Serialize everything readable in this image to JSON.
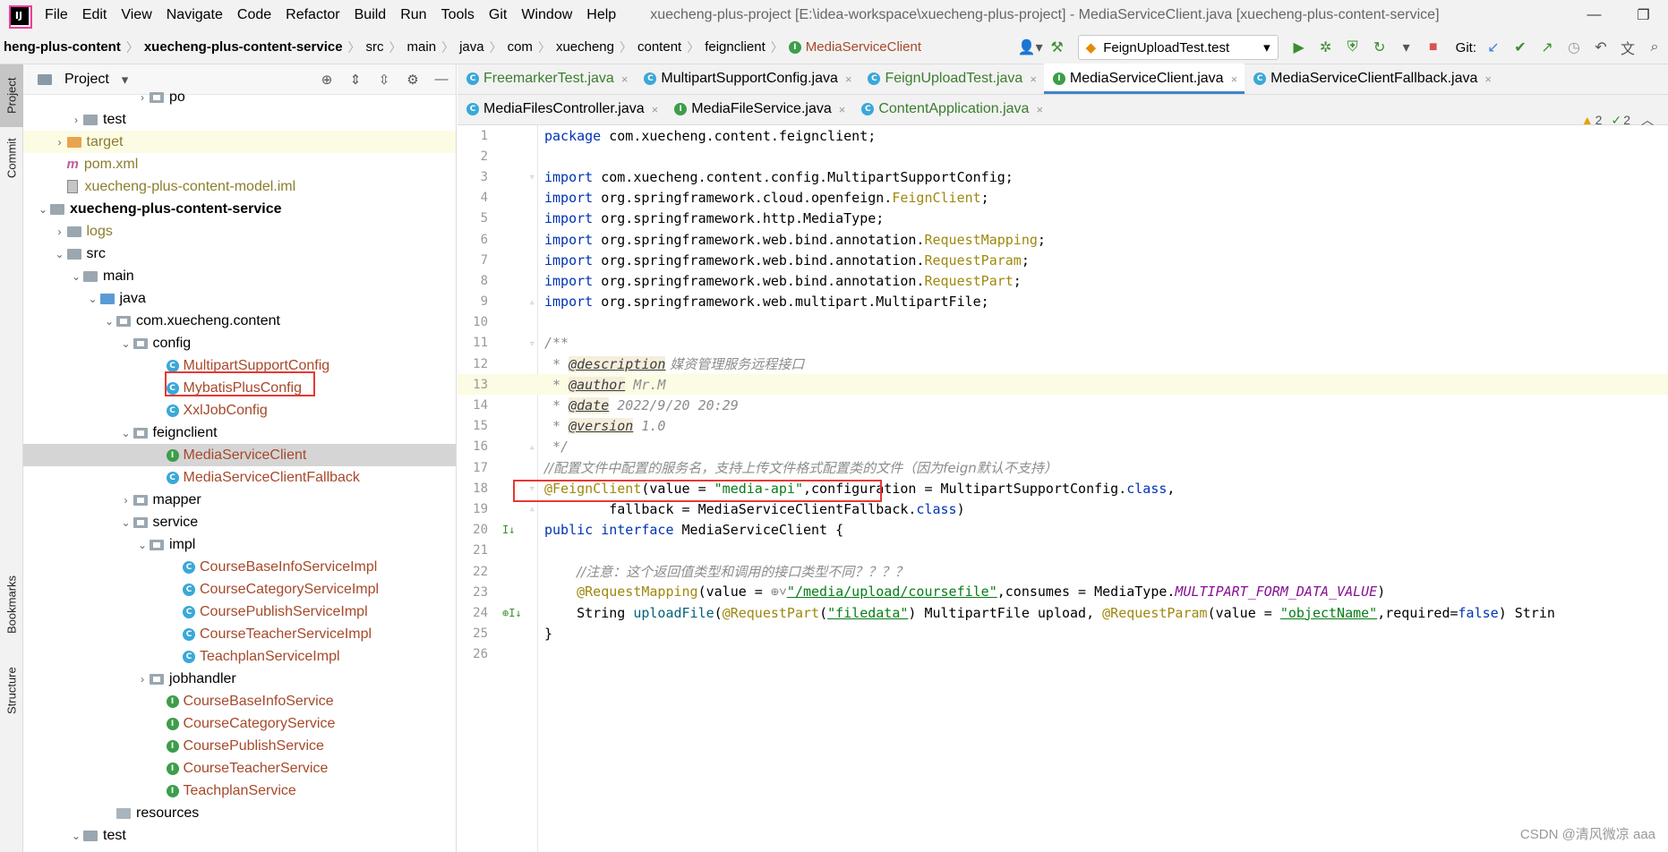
{
  "app": {
    "window_title": "xuecheng-plus-project [E:\\idea-workspace\\xuecheng-plus-project] - MediaServiceClient.java [xuecheng-plus-content-service]",
    "menu": [
      "File",
      "Edit",
      "View",
      "Navigate",
      "Code",
      "Refactor",
      "Build",
      "Run",
      "Tools",
      "Git",
      "Window",
      "Help"
    ]
  },
  "breadcrumb": [
    "heng-plus-content",
    "xuecheng-plus-content-service",
    "src",
    "main",
    "java",
    "com",
    "xuecheng",
    "content",
    "feignclient",
    "MediaServiceClient"
  ],
  "toolbar": {
    "run_config": "FeignUploadTest.test",
    "git_label": "Git:"
  },
  "left_strip": {
    "project": "Project",
    "commit": "Commit",
    "bookmarks": "Bookmarks",
    "structure": "Structure"
  },
  "project_panel": {
    "title": "Project",
    "tree": [
      {
        "label": "po",
        "kind": "pkg",
        "level": 8,
        "arrow": ">"
      },
      {
        "label": "test",
        "kind": "folder",
        "level": 4,
        "arrow": ">"
      },
      {
        "label": "target",
        "kind": "folder-orange",
        "level": 3,
        "arrow": ">",
        "color": "olive"
      },
      {
        "label": "pom.xml",
        "kind": "maven",
        "level": 3,
        "arrow": "",
        "color": "olive"
      },
      {
        "label": "xuecheng-plus-content-model.iml",
        "kind": "iml",
        "level": 3,
        "arrow": "",
        "color": "olive"
      },
      {
        "label": "xuecheng-plus-content-service",
        "kind": "module",
        "level": 2,
        "arrow": "v",
        "bold": true
      },
      {
        "label": "logs",
        "kind": "folder",
        "level": 3,
        "arrow": ">",
        "color": "olive"
      },
      {
        "label": "src",
        "kind": "folder",
        "level": 3,
        "arrow": "v"
      },
      {
        "label": "main",
        "kind": "folder",
        "level": 4,
        "arrow": "v"
      },
      {
        "label": "java",
        "kind": "folder-blue",
        "level": 5,
        "arrow": "v"
      },
      {
        "label": "com.xuecheng.content",
        "kind": "pkg",
        "level": 6,
        "arrow": "v"
      },
      {
        "label": "config",
        "kind": "pkg",
        "level": 7,
        "arrow": "v"
      },
      {
        "label": "MultipartSupportConfig",
        "kind": "class",
        "level": 9,
        "arrow": "",
        "color": "brown"
      },
      {
        "label": "MybatisPlusConfig",
        "kind": "class",
        "level": 9,
        "arrow": "",
        "color": "brown"
      },
      {
        "label": "XxlJobConfig",
        "kind": "class",
        "level": 9,
        "arrow": "",
        "color": "brown"
      },
      {
        "label": "feignclient",
        "kind": "pkg",
        "level": 7,
        "arrow": "v"
      },
      {
        "label": "MediaServiceClient",
        "kind": "interface",
        "level": 9,
        "arrow": "",
        "color": "brown",
        "selected": true
      },
      {
        "label": "MediaServiceClientFallback",
        "kind": "class",
        "level": 9,
        "arrow": "",
        "color": "brown"
      },
      {
        "label": "mapper",
        "kind": "pkg",
        "level": 7,
        "arrow": ">"
      },
      {
        "label": "service",
        "kind": "pkg",
        "level": 7,
        "arrow": "v"
      },
      {
        "label": "impl",
        "kind": "pkg",
        "level": 8,
        "arrow": "v"
      },
      {
        "label": "CourseBaseInfoServiceImpl",
        "kind": "class",
        "level": 10,
        "arrow": "",
        "color": "brown"
      },
      {
        "label": "CourseCategoryServiceImpl",
        "kind": "class",
        "level": 10,
        "arrow": "",
        "color": "brown"
      },
      {
        "label": "CoursePublishServiceImpl",
        "kind": "class",
        "level": 10,
        "arrow": "",
        "color": "brown"
      },
      {
        "label": "CourseTeacherServiceImpl",
        "kind": "class",
        "level": 10,
        "arrow": "",
        "color": "brown"
      },
      {
        "label": "TeachplanServiceImpl",
        "kind": "class",
        "level": 10,
        "arrow": "",
        "color": "brown"
      },
      {
        "label": "jobhandler",
        "kind": "pkg",
        "level": 8,
        "arrow": ">"
      },
      {
        "label": "CourseBaseInfoService",
        "kind": "interface",
        "level": 9,
        "arrow": "",
        "color": "brown"
      },
      {
        "label": "CourseCategoryService",
        "kind": "interface",
        "level": 9,
        "arrow": "",
        "color": "brown"
      },
      {
        "label": "CoursePublishService",
        "kind": "interface",
        "level": 9,
        "arrow": "",
        "color": "brown"
      },
      {
        "label": "CourseTeacherService",
        "kind": "interface",
        "level": 9,
        "arrow": "",
        "color": "brown"
      },
      {
        "label": "TeachplanService",
        "kind": "interface",
        "level": 9,
        "arrow": "",
        "color": "brown"
      },
      {
        "label": "resources",
        "kind": "folder-res",
        "level": 6,
        "arrow": ""
      },
      {
        "label": "test",
        "kind": "folder",
        "level": 4,
        "arrow": "v"
      }
    ]
  },
  "editor_tabs_row1": [
    {
      "label": "FreemarkerTest.java",
      "icon": "class",
      "green": true
    },
    {
      "label": "MultipartSupportConfig.java",
      "icon": "class",
      "green": false
    },
    {
      "label": "FeignUploadTest.java",
      "icon": "class",
      "green": true
    },
    {
      "label": "MediaServiceClient.java",
      "icon": "interface",
      "green": false,
      "active": true
    },
    {
      "label": "MediaServiceClientFallback.java",
      "icon": "class",
      "green": false
    }
  ],
  "editor_tabs_row2": [
    {
      "label": "MediaFilesController.java",
      "icon": "class",
      "green": false
    },
    {
      "label": "MediaFileService.java",
      "icon": "interface",
      "green": false
    },
    {
      "label": "ContentApplication.java",
      "icon": "class",
      "green": true
    }
  ],
  "inspections": {
    "warnings": "2",
    "weak": "2"
  },
  "code": {
    "l1": "com.xuecheng.content.feignclient;",
    "l3": "com.xuecheng.content.config.MultipartSupportConfig;",
    "l4a": "org.springframework.cloud.openfeign.",
    "l4b": "FeignClient",
    "l5": "org.springframework.http.MediaType;",
    "l6a": "org.springframework.web.bind.annotation.",
    "l6b": "RequestMapping",
    "l7a": "org.springframework.web.bind.annotation.",
    "l7b": "RequestParam",
    "l8a": "org.springframework.web.bind.annotation.",
    "l8b": "RequestPart",
    "l9": "org.springframework.web.multipart.MultipartFile;",
    "l12_tag": "@description",
    "l12_text": " 媒资管理服务远程接口",
    "l13_tag": "@author",
    "l13_text": " Mr.M",
    "l14_tag": "@date",
    "l14_text": " 2022/9/20 20:29",
    "l15_tag": "@version",
    "l15_text": " 1.0",
    "l17": "//配置文件中配置的服务名，支持上传文件格式配置类的文件（因为feign默认不支持）",
    "l18_val": "\"media-api\"",
    "l18_conf": "MultipartSupportConfig.",
    "l19_fb": "fallback = MediaServiceClientFallback.",
    "l20_name": " MediaServiceClient ",
    "l22": "//注意：这个返回值类型和调用的接口类型不同？？？？",
    "l23_path": "\"/media/upload/coursefile\"",
    "l23_const": "MULTIPART_FORM_DATA_VALUE",
    "l24_method": "uploadFile",
    "l24_part": "\"filedata\"",
    "l24_obj": "\"objectName\"",
    "l24_false": "false"
  },
  "watermark": "CSDN @清风微凉 aaa"
}
